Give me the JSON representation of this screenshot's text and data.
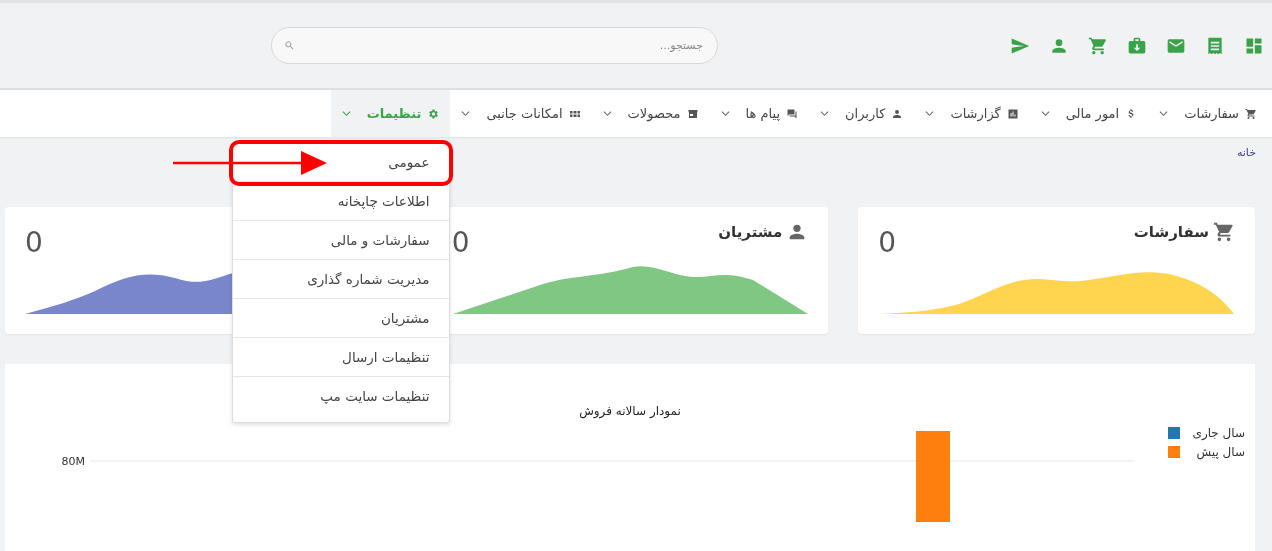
{
  "header": {
    "search": {
      "placeholder": "جستجو..."
    }
  },
  "nav": [
    {
      "label": "سفارشات",
      "selected": false
    },
    {
      "label": "امور مالی",
      "selected": false
    },
    {
      "label": "گزارشات",
      "selected": false
    },
    {
      "label": "کاربران",
      "selected": false
    },
    {
      "label": "پیام ها",
      "selected": false
    },
    {
      "label": "محصولات",
      "selected": false
    },
    {
      "label": "امکانات جانبی",
      "selected": false
    },
    {
      "label": "تنظیمات",
      "selected": true
    }
  ],
  "settings_menu": [
    {
      "label": "عمومی",
      "highlighted": true
    },
    {
      "label": "اطلاعات چاپخانه",
      "highlighted": false
    },
    {
      "label": "سفارشات و مالی",
      "highlighted": false
    },
    {
      "label": "مدیریت شماره گذاری",
      "highlighted": false
    },
    {
      "label": "مشتریان",
      "highlighted": false
    },
    {
      "label": "تنظیمات ارسال",
      "highlighted": false
    },
    {
      "label": "تنظیمات سایت مپ",
      "highlighted": false
    }
  ],
  "breadcrumb": "خانه",
  "stat_cards": [
    {
      "title": "سفارشات",
      "value": "0",
      "color": "#ffd54f"
    },
    {
      "title": "مشتریان",
      "value": "0",
      "color": "#81c784"
    },
    {
      "value": "0",
      "color": "#7986cb"
    }
  ],
  "sales_chart": {
    "title": "نمودار سالانه فروش",
    "y_tick_label": "80M",
    "legend": [
      {
        "label": "سال جاری",
        "color": "#1f77b4"
      },
      {
        "label": "سال پیش",
        "color": "#ff7f0e"
      }
    ]
  }
}
